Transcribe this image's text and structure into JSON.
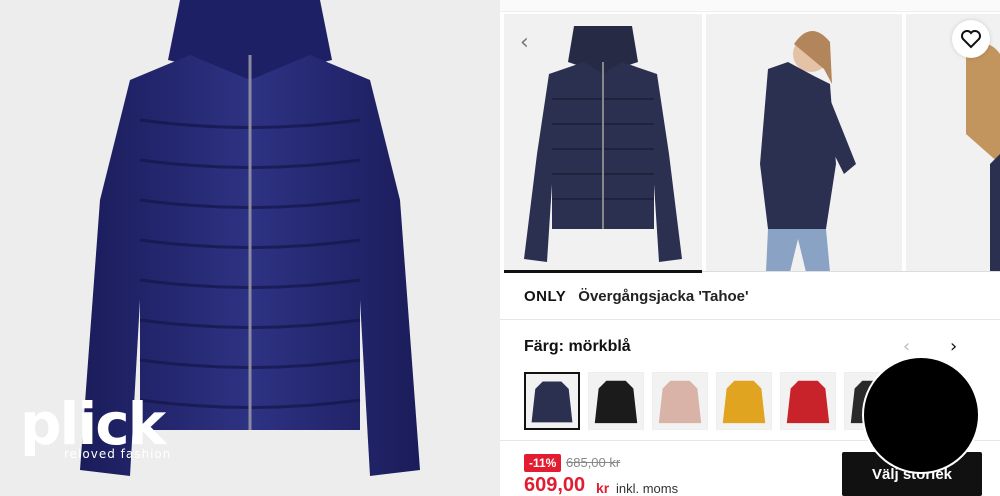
{
  "watermark": {
    "logo": "plick",
    "tagline": "reloved fashion"
  },
  "product": {
    "brand": "ONLY",
    "name": "Övergångsjacka 'Tahoe'",
    "color_label": "Färg:",
    "color_value": "mörkblå",
    "discount": "-11%",
    "old_price": "685,00 kr",
    "price": "609,00",
    "currency": "kr",
    "vat_note": "inkl. moms",
    "size_button": "Välj storlek"
  },
  "gallery": {
    "prev_icon": "chevron-left-icon",
    "favorite_icon": "heart-icon",
    "image_count_visible": 3
  },
  "swatches": [
    {
      "name": "navy",
      "color": "#2c3050",
      "selected": true
    },
    {
      "name": "black",
      "color": "#1b1b1b",
      "selected": false
    },
    {
      "name": "rose",
      "color": "#d9b3a8",
      "selected": false
    },
    {
      "name": "yellow",
      "color": "#e0a420",
      "selected": false
    },
    {
      "name": "red",
      "color": "#c8232a",
      "selected": false
    },
    {
      "name": "partial",
      "color": "#2a2a2a",
      "selected": false
    }
  ],
  "colors": {
    "accent_red": "#e21d32",
    "jacket_navy": "#23266b",
    "button_black": "#111111"
  }
}
